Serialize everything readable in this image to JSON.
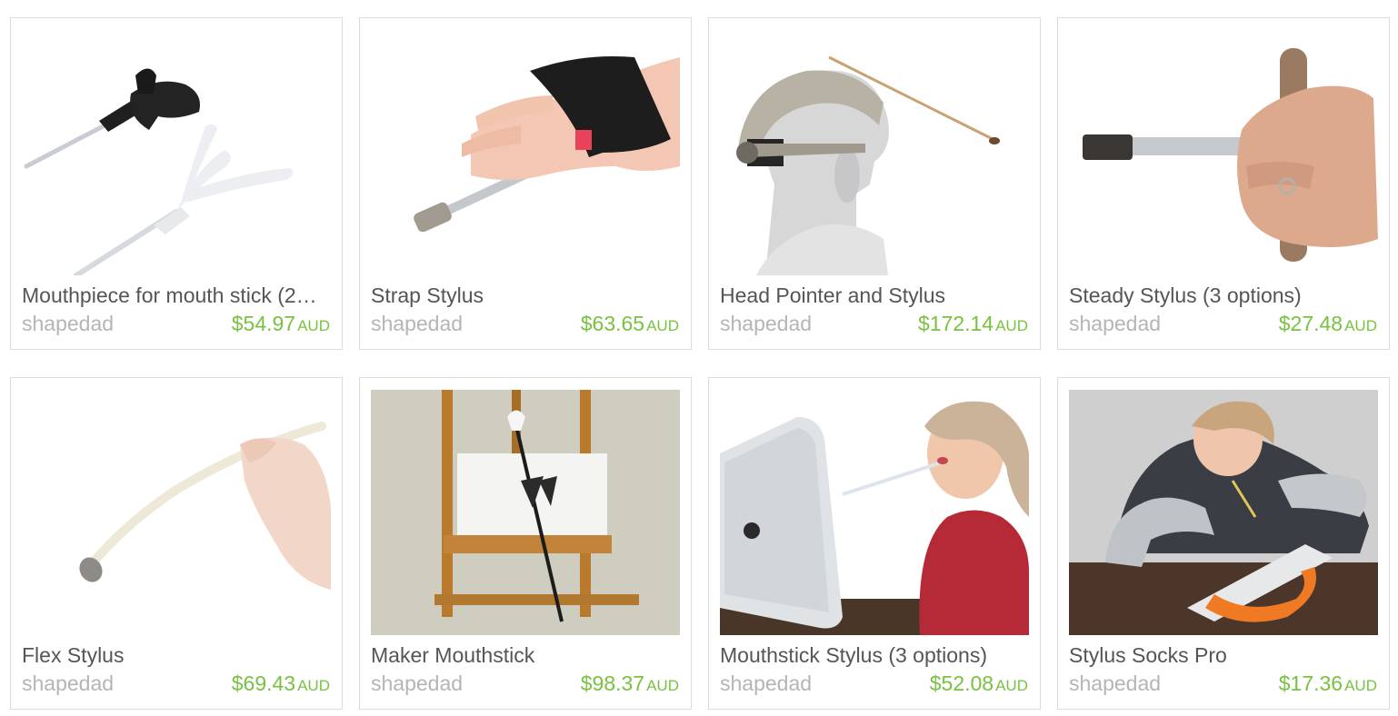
{
  "colors": {
    "title": "#555555",
    "shop": "#b5b5b5",
    "price": "#7ac142",
    "border": "#dcdcdc"
  },
  "products": [
    {
      "title": "Mouthpiece for mouth stick (2…",
      "shop": "shapedad",
      "price": "$54.97",
      "currency": "AUD",
      "image": "mouthpiece-photo"
    },
    {
      "title": "Strap Stylus",
      "shop": "shapedad",
      "price": "$63.65",
      "currency": "AUD",
      "image": "strap-stylus-photo"
    },
    {
      "title": "Head Pointer and Stylus",
      "shop": "shapedad",
      "price": "$172.14",
      "currency": "AUD",
      "image": "head-pointer-photo"
    },
    {
      "title": "Steady Stylus (3 options)",
      "shop": "shapedad",
      "price": "$27.48",
      "currency": "AUD",
      "image": "steady-stylus-photo"
    },
    {
      "title": "Flex Stylus",
      "shop": "shapedad",
      "price": "$69.43",
      "currency": "AUD",
      "image": "flex-stylus-photo"
    },
    {
      "title": "Maker Mouthstick",
      "shop": "shapedad",
      "price": "$98.37",
      "currency": "AUD",
      "image": "maker-mouthstick-photo"
    },
    {
      "title": "Mouthstick Stylus (3 options)",
      "shop": "shapedad",
      "price": "$52.08",
      "currency": "AUD",
      "image": "mouthstick-stylus-photo"
    },
    {
      "title": "Stylus Socks Pro",
      "shop": "shapedad",
      "price": "$17.36",
      "currency": "AUD",
      "image": "stylus-socks-photo"
    }
  ]
}
